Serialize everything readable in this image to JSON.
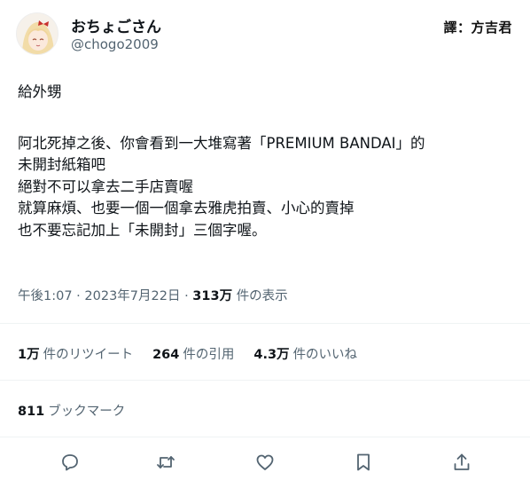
{
  "user": {
    "display_name": "おちょごさん",
    "handle": "@chogo2009",
    "avatar_icon": "anime-girl-avatar"
  },
  "watermark": "譯：方吉君",
  "tweet": {
    "line_1": "給外甥",
    "line_2": "阿北死掉之後、你會看到一大堆寫著「PREMIUM BANDAI」的",
    "line_3": "未開封紙箱吧",
    "line_4": "絕對不可以拿去二手店賣喔",
    "line_5": "就算麻煩、也要一個一個拿去雅虎拍賣、小心的賣掉",
    "line_6": "也不要忘記加上「未開封」三個字喔。"
  },
  "meta": {
    "time": "午後1:07",
    "separator_1": "·",
    "date": "2023年7月22日",
    "separator_2": "·",
    "views_count": "313万",
    "views_label": "件の表示"
  },
  "stats": {
    "retweets_count": "1万",
    "retweets_label": "件のリツイート",
    "quotes_count": "264",
    "quotes_label": "件の引用",
    "likes_count": "4.3万",
    "likes_label": "件のいいね"
  },
  "bookmarks": {
    "count": "811",
    "label": "ブックマーク"
  },
  "actions": [
    "reply-icon",
    "retweet-icon",
    "like-icon",
    "bookmark-icon",
    "share-icon"
  ],
  "colors": {
    "text_primary": "#0f1419",
    "text_secondary": "#536471",
    "divider": "#eff3f4"
  }
}
